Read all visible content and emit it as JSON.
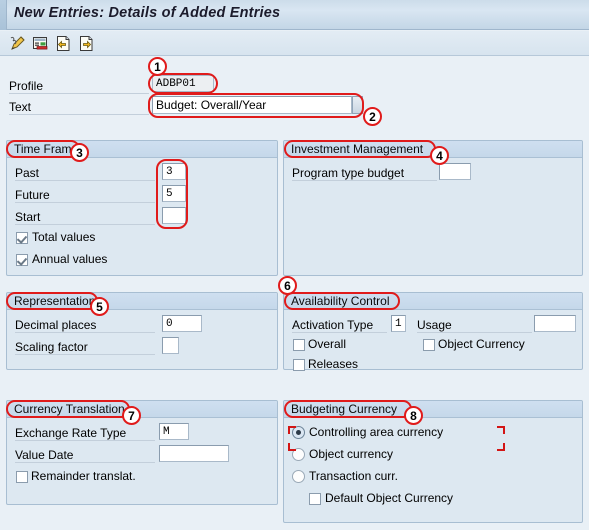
{
  "window": {
    "title": "New Entries: Details of Added Entries"
  },
  "toolbar": {
    "icons": [
      {
        "name": "pencil-edit-icon",
        "title": "Edit"
      },
      {
        "name": "document-display-icon",
        "title": "Display"
      },
      {
        "name": "previous-entry-icon",
        "title": "Previous Entry"
      },
      {
        "name": "next-entry-icon",
        "title": "Next Entry"
      }
    ]
  },
  "header": {
    "profile_label": "Profile",
    "profile_value": "ADBP01",
    "text_label": "Text",
    "text_value": "Budget: Overall/Year"
  },
  "time_frame": {
    "title": "Time Frame",
    "past_label": "Past",
    "past_value": "3",
    "future_label": "Future",
    "future_value": "5",
    "start_label": "Start",
    "start_value": "",
    "total_values_label": "Total values",
    "total_values_checked": true,
    "annual_values_label": "Annual values",
    "annual_values_checked": true
  },
  "investment_management": {
    "title": "Investment Management",
    "program_type_budget_label": "Program type budget",
    "program_type_budget_value": ""
  },
  "representation": {
    "title": "Representation",
    "decimal_places_label": "Decimal places",
    "decimal_places_value": "0",
    "scaling_factor_label": "Scaling factor",
    "scaling_factor_value": ""
  },
  "availability_control": {
    "title": "Availability Control",
    "activation_type_label": "Activation Type",
    "activation_type_value": "1",
    "usage_label": "Usage",
    "usage_value": "",
    "overall_label": "Overall",
    "overall_checked": false,
    "object_currency_label": "Object Currency",
    "object_currency_checked": false,
    "releases_label": "Releases",
    "releases_checked": false
  },
  "currency_translation": {
    "title": "Currency Translation",
    "exchange_rate_type_label": "Exchange Rate Type",
    "exchange_rate_type_value": "M",
    "value_date_label": "Value Date",
    "value_date_value": "",
    "remainder_translat_label": "Remainder translat.",
    "remainder_translat_checked": false
  },
  "budgeting_currency": {
    "title": "Budgeting Currency",
    "controlling_area_currency_label": "Controlling area currency",
    "object_currency_label": "Object currency",
    "transaction_curr_label": "Transaction curr.",
    "selected": "controlling_area_currency",
    "default_object_currency_label": "Default Object Currency",
    "default_object_currency_checked": false
  },
  "annotations": {
    "accent_color": "#e01b1b",
    "markers": [
      {
        "id": "1",
        "target": "profile-value-field"
      },
      {
        "id": "2",
        "target": "text-value-field"
      },
      {
        "id": "3",
        "target": "time-frame-title"
      },
      {
        "id": "4",
        "target": "investment-management-title"
      },
      {
        "id": "5",
        "target": "representation-title"
      },
      {
        "id": "6",
        "target": "availability-control-title"
      },
      {
        "id": "7",
        "target": "currency-translation-title"
      },
      {
        "id": "8",
        "target": "budgeting-currency-title"
      }
    ]
  }
}
